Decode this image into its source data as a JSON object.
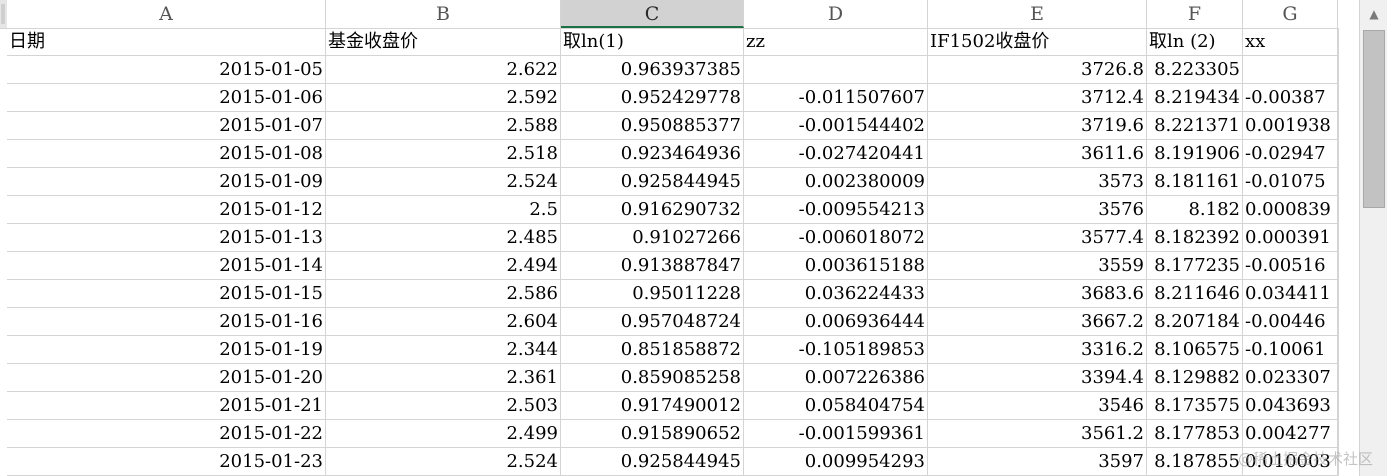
{
  "columns": [
    "A",
    "B",
    "C",
    "D",
    "E",
    "F",
    "G"
  ],
  "selected_column": "C",
  "header_row": [
    "日期",
    "基金收盘价",
    "取ln(1)",
    "zz",
    "IF1502收盘价",
    "取ln (2)",
    "xx"
  ],
  "rows": [
    [
      "2015-01-05",
      "2.622",
      "0.963937385",
      "",
      "3726.8",
      "8.223305",
      ""
    ],
    [
      "2015-01-06",
      "2.592",
      "0.952429778",
      "-0.011507607",
      "3712.4",
      "8.219434",
      "-0.00387"
    ],
    [
      "2015-01-07",
      "2.588",
      "0.950885377",
      "-0.001544402",
      "3719.6",
      "8.221371",
      "0.001938"
    ],
    [
      "2015-01-08",
      "2.518",
      "0.923464936",
      "-0.027420441",
      "3611.6",
      "8.191906",
      "-0.02947"
    ],
    [
      "2015-01-09",
      "2.524",
      "0.925844945",
      "0.002380009",
      "3573",
      "8.181161",
      "-0.01075"
    ],
    [
      "2015-01-12",
      "2.5",
      "0.916290732",
      "-0.009554213",
      "3576",
      "8.182",
      "0.000839"
    ],
    [
      "2015-01-13",
      "2.485",
      "0.91027266",
      "-0.006018072",
      "3577.4",
      "8.182392",
      "0.000391"
    ],
    [
      "2015-01-14",
      "2.494",
      "0.913887847",
      "0.003615188",
      "3559",
      "8.177235",
      "-0.00516"
    ],
    [
      "2015-01-15",
      "2.586",
      "0.95011228",
      "0.036224433",
      "3683.6",
      "8.211646",
      "0.034411"
    ],
    [
      "2015-01-16",
      "2.604",
      "0.957048724",
      "0.006936444",
      "3667.2",
      "8.207184",
      "-0.00446"
    ],
    [
      "2015-01-19",
      "2.344",
      "0.851858872",
      "-0.105189853",
      "3316.2",
      "8.106575",
      "-0.10061"
    ],
    [
      "2015-01-20",
      "2.361",
      "0.859085258",
      "0.007226386",
      "3394.4",
      "8.129882",
      "0.023307"
    ],
    [
      "2015-01-21",
      "2.503",
      "0.917490012",
      "0.058404754",
      "3546",
      "8.173575",
      "0.043693"
    ],
    [
      "2015-01-22",
      "2.499",
      "0.915890652",
      "-0.001599361",
      "3561.2",
      "8.177853",
      "0.004277"
    ],
    [
      "2015-01-23",
      "2.524",
      "0.925844945",
      "0.009954293",
      "3597",
      "8.187855",
      "0.010003"
    ]
  ],
  "watermark": "@稀土掘金技术社区",
  "colors": {
    "selected_header_bg": "#d2d2d2",
    "selected_header_underline": "#1e7145",
    "gridline": "#d4d4d4"
  },
  "icons": {
    "scroll_up": "scroll-up-arrow-icon"
  }
}
